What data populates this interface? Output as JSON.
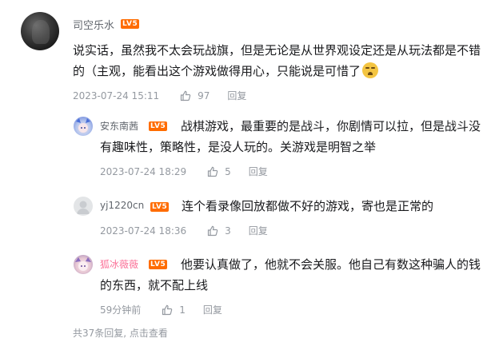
{
  "main_comment": {
    "username": "司空乐水",
    "level": "LV5",
    "text": "说实话，虽然我不太会玩战旗，但是无论是从世界观设定还是从玩法都是不错的（主观，能看出这个游戏做得用心，只能说是可惜了",
    "emoji": "sad-face-emoji",
    "time": "2023-07-24 15:11",
    "likes": "97",
    "reply_label": "回复"
  },
  "replies": [
    {
      "username": "安东南茜",
      "username_color": "#61666d",
      "level": "LV5",
      "text": "战棋游戏，最重要的是战斗，你剧情可以拉，但是战斗没有趣味性，策略性，是没人玩的。关游戏是明智之举",
      "time": "2023-07-24 18:29",
      "likes": "5",
      "reply_label": "回复"
    },
    {
      "username": "yj1220cn",
      "username_color": "#61666d",
      "level": "LV5",
      "text": "连个看录像回放都做不好的游戏，寄也是正常的",
      "time": "2023-07-24 18:36",
      "likes": "3",
      "reply_label": "回复"
    },
    {
      "username": "狐冰薇薇",
      "username_color": "#fb7299",
      "level": "LV5",
      "text": "他要认真做了，他就不会关服。他自己有数这种骗人的钱的东西，就不配上线",
      "time": "59分钟前",
      "likes": "1",
      "reply_label": "回复"
    }
  ],
  "footer": {
    "text": "共37条回复, 点击查看"
  },
  "colors": {
    "level_badge": "#ff6c00",
    "meta_text": "#9499a0",
    "body_text": "#18191c",
    "vip_name": "#fb7299"
  }
}
